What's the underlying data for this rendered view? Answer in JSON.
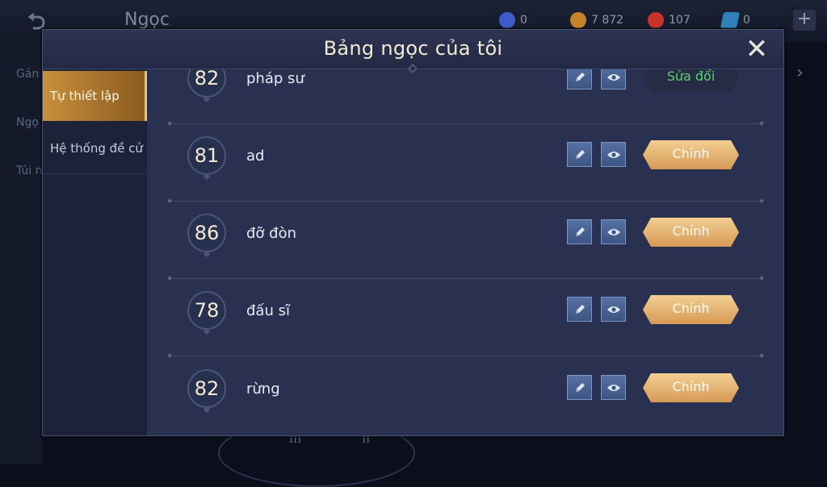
{
  "background": {
    "title": "Ngọc",
    "currencies": [
      {
        "icon": "blue-gem-icon",
        "value": "0",
        "color": "#3d5cc8"
      },
      {
        "icon": "gold-coin-icon",
        "value": "7 872",
        "color": "#c8822a"
      },
      {
        "icon": "red-voucher-icon",
        "value": "107",
        "color": "#c8322a"
      },
      {
        "icon": "blue-card-icon",
        "value": "0",
        "color": "#2f7fb8"
      }
    ],
    "plus_label": "+",
    "side_labels": [
      "Gán",
      "Ngọ",
      "Túi n"
    ],
    "roman": [
      "III",
      "II"
    ]
  },
  "modal": {
    "title": "Bảng ngọc của tôi",
    "close_label": "✕",
    "tabs": [
      {
        "label": "Tự thiết lập",
        "active": true
      },
      {
        "label": "Hệ thống đề cử",
        "active": false
      }
    ],
    "rows": [
      {
        "level": "82",
        "name": "pháp sư",
        "action": "Sửa đổi",
        "action_style": "secondary"
      },
      {
        "level": "81",
        "name": "ad",
        "action": "Chỉnh",
        "action_style": "primary"
      },
      {
        "level": "86",
        "name": "đỡ đòn",
        "action": "Chỉnh",
        "action_style": "primary"
      },
      {
        "level": "78",
        "name": "đấu sĩ",
        "action": "Chỉnh",
        "action_style": "primary"
      },
      {
        "level": "82",
        "name": "rừng",
        "action": "Chỉnh",
        "action_style": "primary"
      }
    ]
  },
  "colors": {
    "accent_gold": "#d69a55",
    "edit_green": "#58d36a",
    "title_cream": "#f3ead2"
  }
}
